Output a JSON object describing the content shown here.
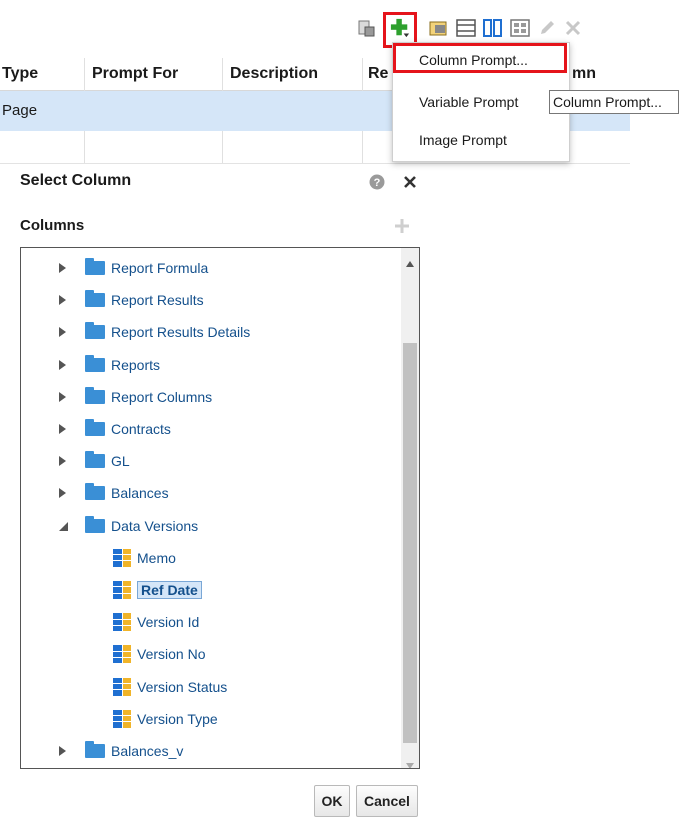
{
  "table": {
    "headers": [
      "Type",
      "Prompt For",
      "Description",
      "Re",
      "mn"
    ],
    "row1": {
      "type": "Page"
    }
  },
  "menu": {
    "items": [
      "Column Prompt...",
      "Variable Prompt",
      "Image Prompt"
    ],
    "tooltip": "Column Prompt..."
  },
  "dialog": {
    "title": "Select Column",
    "subtitle": "Columns",
    "tree": [
      {
        "label": "Report Formula",
        "kind": "folder"
      },
      {
        "label": "Report Results",
        "kind": "folder"
      },
      {
        "label": "Report Results Details",
        "kind": "folder"
      },
      {
        "label": "Reports",
        "kind": "folder"
      },
      {
        "label": "Report Columns",
        "kind": "folder"
      },
      {
        "label": "Contracts",
        "kind": "folder"
      },
      {
        "label": "GL",
        "kind": "folder"
      },
      {
        "label": "Balances",
        "kind": "folder"
      },
      {
        "label": "Data Versions",
        "kind": "folder-open"
      },
      {
        "label": "Memo",
        "kind": "column"
      },
      {
        "label": "Ref Date",
        "kind": "column-selected"
      },
      {
        "label": "Version Id",
        "kind": "column"
      },
      {
        "label": "Version No",
        "kind": "column"
      },
      {
        "label": "Version Status",
        "kind": "column"
      },
      {
        "label": "Version Type",
        "kind": "column"
      },
      {
        "label": "Balances_v",
        "kind": "folder"
      }
    ],
    "ok_label": "OK",
    "cancel_label": "Cancel"
  },
  "colors": {
    "accent": "#3a8fd6",
    "highlight": "#e5141b",
    "row_selected": "#d5e6f8",
    "link": "#14508c"
  }
}
